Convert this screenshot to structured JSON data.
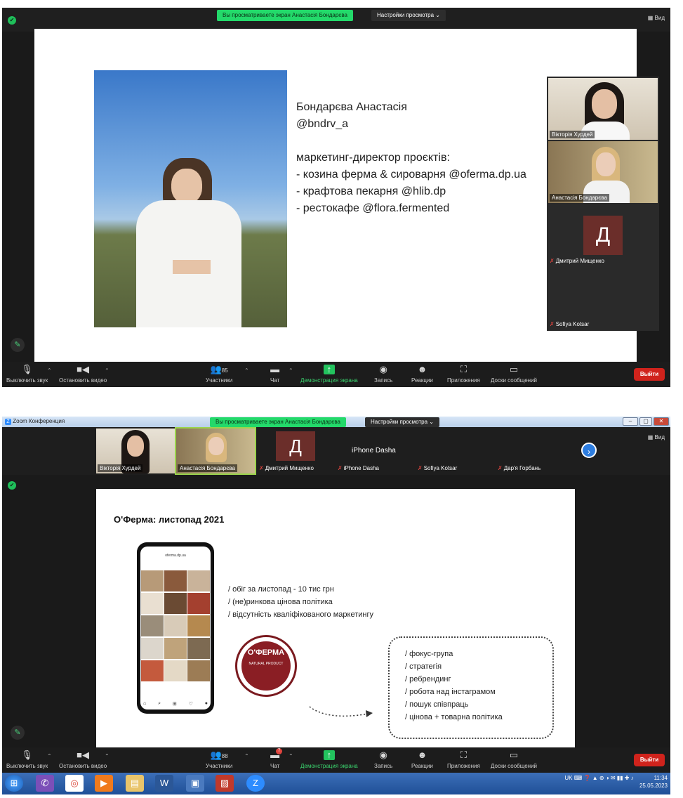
{
  "shot1": {
    "share_banner": "Вы просматриваете экран Анастасія Бондарєва",
    "view_options": "Настройки просмотра",
    "view_right": "Вид",
    "slide": {
      "lines": [
        "Бондарєва Анастасія",
        "@bndrv_a",
        "",
        "маркетинг-директор проєктів:",
        "- козина ферма & сироварня @oferma.dp.ua",
        "- крафтова пекарня @hlib.dp",
        "- рестокафе @flora.fermented"
      ]
    },
    "participants": [
      {
        "name": "Вікторія Хурдей"
      },
      {
        "name": "Анастасія Бондарєва"
      },
      {
        "name": "Дмитрий Мищенко",
        "initial": "Д"
      },
      {
        "name": "Sofiya Kotsar"
      }
    ],
    "toolbar": {
      "mute": "Выключить звук",
      "video": "Остановить видео",
      "participants_count": "85",
      "participants": "Участники",
      "chat": "Чат",
      "share": "Демонстрация экрана",
      "record": "Запись",
      "reactions": "Реакции",
      "apps": "Приложения",
      "whiteboards": "Доски сообщений",
      "leave": "Выйти"
    }
  },
  "shot2": {
    "window_title": "Zoom Конференция",
    "share_banner": "Вы просматриваете экран Анастасія Бондарєва",
    "view_options": "Настройки просмотра",
    "view_right": "Вид",
    "strip": [
      {
        "name": "Вікторія Хурдей"
      },
      {
        "name": "Анастасія Бондарєва"
      },
      {
        "name": "Дмитрий Мищенко",
        "initial": "Д"
      },
      {
        "name": "iPhone Dasha",
        "title": "iPhone Dasha"
      },
      {
        "name": "Sofiya Kotsar"
      },
      {
        "name": "Дар'я Горбань"
      }
    ],
    "slide": {
      "title": "О'Ферма: листопад 2021",
      "phone_handle": "oferma.dp.ua",
      "logo_text": "О'ФЕРМА",
      "logo_sub": "NATURAL PRODUCT",
      "bullets_main": [
        "/ обіг за листопад - 10 тис грн",
        "/ (не)ринкова цінова політика",
        "/ відсутність кваліфікованого маркетингу"
      ],
      "bullets_bubble": [
        "/ фокус-група",
        "/ стратегія",
        "/ ребрендинг",
        "/ робота над інстаграмом",
        "/ пошук співпраць",
        "/ цінова + товарна політика"
      ]
    },
    "toolbar": {
      "mute": "Выключить звук",
      "video": "Остановить видео",
      "participants_count": "88",
      "participants": "Участники",
      "chat": "Чат",
      "chat_badge": "7",
      "share": "Демонстрация экрана",
      "record": "Запись",
      "reactions": "Реакции",
      "apps": "Приложения",
      "whiteboards": "Доски сообщений",
      "leave": "Выйти"
    },
    "taskbar": {
      "lang": "UK",
      "time": "11:34",
      "date": "25.05.2023"
    }
  },
  "icons": [
    "shield-icon",
    "mic-icon",
    "video-icon",
    "people-icon",
    "chat-icon",
    "share-icon",
    "record-icon",
    "reactions-icon",
    "apps-icon",
    "whiteboard-icon",
    "pencil-icon",
    "next-icon"
  ]
}
